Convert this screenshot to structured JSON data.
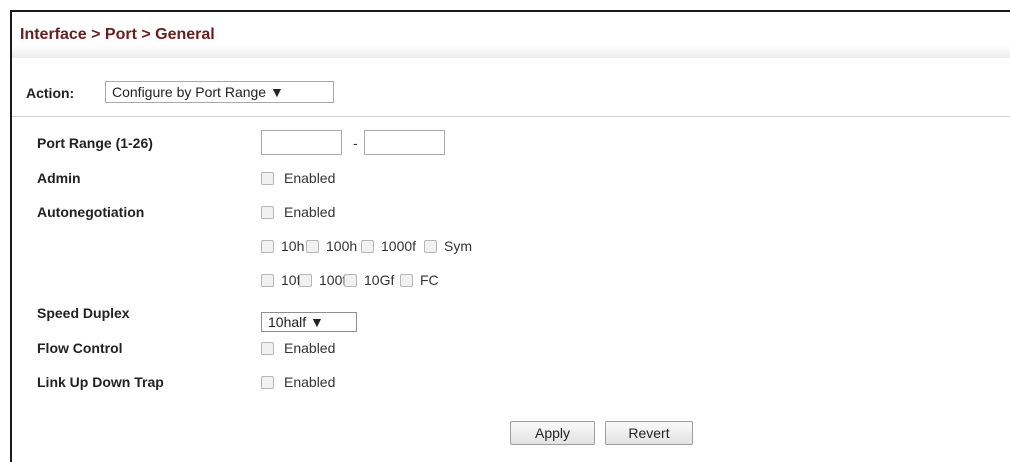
{
  "header": {
    "title": "Interface > Port > General"
  },
  "action": {
    "label": "Action:",
    "selected": "Configure by Port Range ▼"
  },
  "form": {
    "port_range": {
      "label": "Port Range (1-26)",
      "separator": "-",
      "from": "",
      "to": ""
    },
    "admin": {
      "label": "Admin",
      "checkbox_label": "Enabled"
    },
    "autoneg": {
      "label": "Autonegotiation",
      "checkbox_label": "Enabled",
      "row1": [
        "10h",
        "100h",
        "1000f",
        "Sym"
      ],
      "row2": [
        "10f",
        "100f",
        "10Gf",
        "FC"
      ]
    },
    "speed_duplex": {
      "label": "Speed Duplex",
      "selected": "10half ▼"
    },
    "flow_control": {
      "label": "Flow Control",
      "checkbox_label": "Enabled"
    },
    "link_trap": {
      "label": "Link Up Down Trap",
      "checkbox_label": "Enabled"
    }
  },
  "buttons": {
    "apply": "Apply",
    "revert": "Revert"
  }
}
